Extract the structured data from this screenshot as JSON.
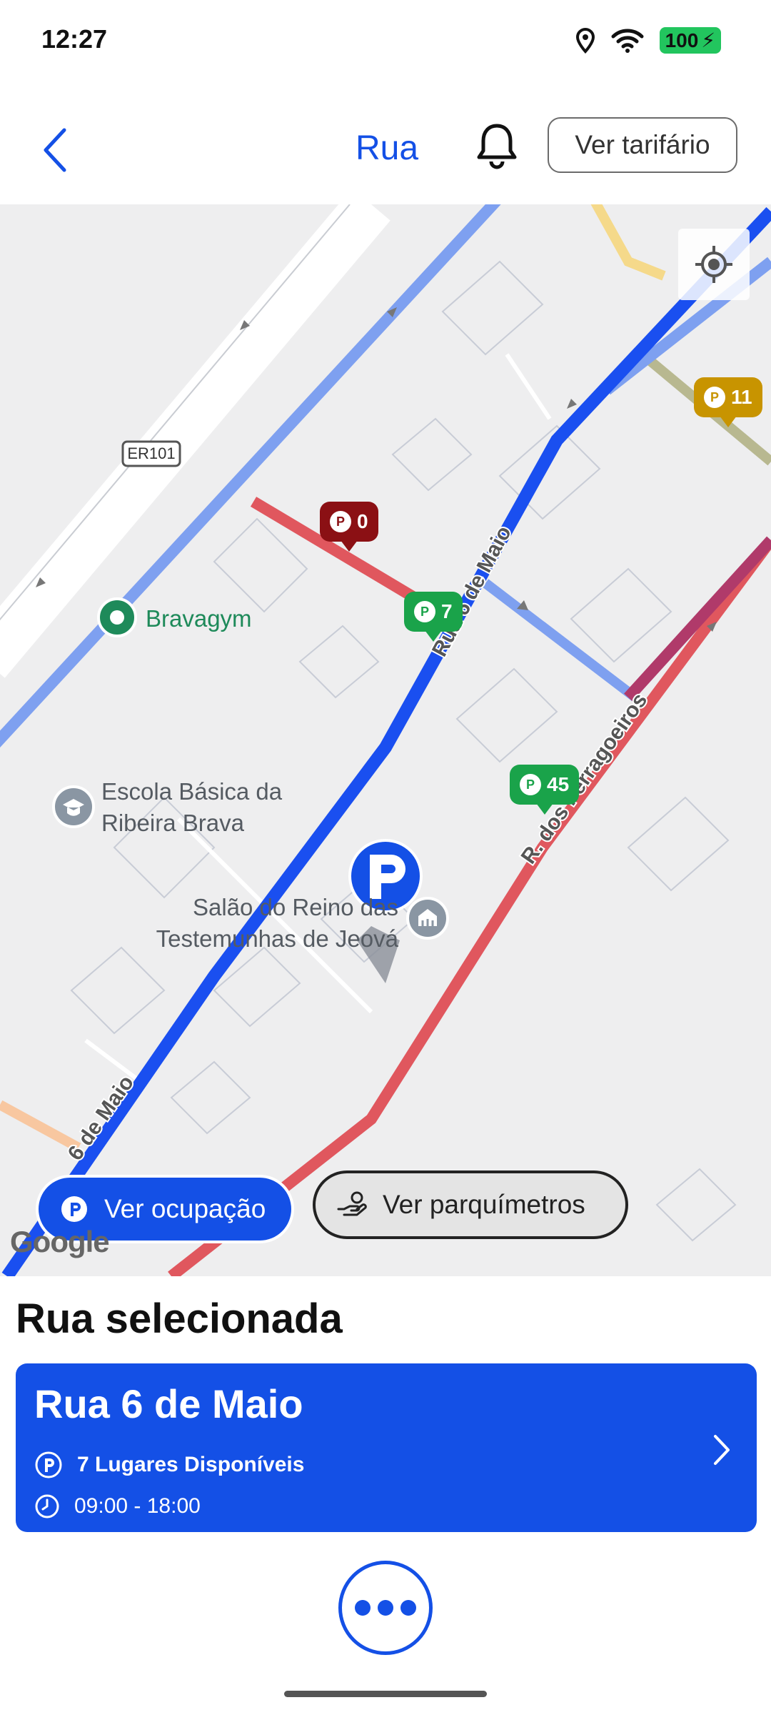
{
  "status_bar": {
    "time": "12:27",
    "battery": "100"
  },
  "header": {
    "title": "Rua",
    "tariff_button": "Ver tarifário"
  },
  "map": {
    "road_shield": "ER101",
    "poi": {
      "gym": "Bravagym",
      "school_line1": "Escola Básica da",
      "school_line2": "Ribeira Brava",
      "hall_line1": "Salão do Reino das",
      "hall_line2": "Testemunhas de Jeová"
    },
    "street_labels": {
      "rua_6_maio_top": "Rua 6 de Maio",
      "rua_6_maio_bottom": "6 de Maio",
      "rua_dos_ferragoeiros": "R. dos Ferragoeiros"
    },
    "markers": [
      {
        "count": "0",
        "color": "#8b1014"
      },
      {
        "count": "7",
        "color": "#1aa34a"
      },
      {
        "count": "45",
        "color": "#1aa34a"
      },
      {
        "count": "11",
        "color": "#c89400"
      }
    ],
    "buttons": {
      "occupancy": "Ver ocupação",
      "meters": "Ver parquímetros"
    },
    "attribution": "Google"
  },
  "panel": {
    "section_title": "Rua selecionada",
    "street": {
      "name": "Rua 6 de Maio",
      "spots": "7 Lugares Disponíveis",
      "hours": "09:00 - 18:00"
    }
  },
  "colors": {
    "accent": "#1450e6",
    "occupied": "#e0575e",
    "available": "#1aa34a"
  }
}
